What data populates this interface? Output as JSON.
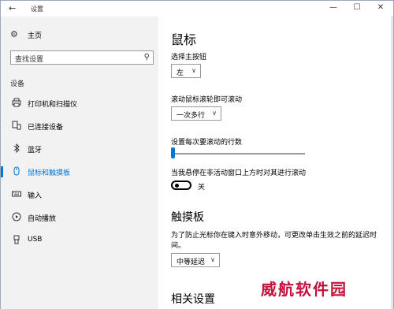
{
  "window": {
    "title": "设置",
    "controls": {
      "minimize": "—",
      "maximize": "☐",
      "close": "✕"
    }
  },
  "sidebar": {
    "home_label": "主页",
    "search_placeholder": "查找设置",
    "section_label": "设备",
    "items": [
      {
        "label": "打印机和扫描仪",
        "icon": "printer-icon"
      },
      {
        "label": "已连接设备",
        "icon": "connected-devices-icon"
      },
      {
        "label": "蓝牙",
        "icon": "bluetooth-icon"
      },
      {
        "label": "鼠标和触摸板",
        "icon": "mouse-icon",
        "selected": true
      },
      {
        "label": "输入",
        "icon": "keyboard-icon"
      },
      {
        "label": "自动播放",
        "icon": "autoplay-icon"
      },
      {
        "label": "USB",
        "icon": "usb-icon"
      }
    ]
  },
  "main": {
    "title": "鼠标",
    "primary_button": {
      "label": "选择主按钮",
      "value": "左"
    },
    "scroll_wheel": {
      "label": "滚动鼠标滚轮即可滚动",
      "value": "一次多行"
    },
    "lines_to_scroll": {
      "label": "设置每次要滚动的行数",
      "level": 0.0
    },
    "inactive_scroll": {
      "label": "当我悬停在非活动窗口上方时对其进行滚动",
      "state_label": "关",
      "on": false
    },
    "touchpad_title": "触摸板",
    "touchpad_desc": "为了防止光标你在键入时意外移动，可更改单击生效之前的延迟时间。",
    "touchpad_delay_value": "中等延迟",
    "related_title": "相关设置"
  },
  "watermark": "威航软件园",
  "colors": {
    "accent": "#0078d7",
    "sidebar_bg": "#f2f2f2",
    "watermark": "#c0143c"
  }
}
